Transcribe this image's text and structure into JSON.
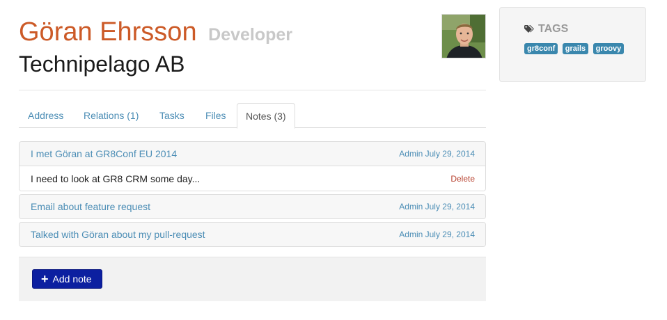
{
  "person": {
    "name": "Göran Ehrsson",
    "title": "Developer",
    "company": "Technipelago AB"
  },
  "tabs": [
    {
      "label": "Address",
      "active": false
    },
    {
      "label": "Relations (1)",
      "active": false
    },
    {
      "label": "Tasks",
      "active": false
    },
    {
      "label": "Files",
      "active": false
    },
    {
      "label": "Notes (3)",
      "active": true
    }
  ],
  "notes": [
    {
      "subject": "I met Göran at GR8Conf EU 2014",
      "meta": "Admin July 29, 2014",
      "body": "I need to look at GR8 CRM some day...",
      "delete_label": "Delete",
      "expanded": true
    },
    {
      "subject": "Email about feature request",
      "meta": "Admin July 29, 2014",
      "expanded": false
    },
    {
      "subject": "Talked with Göran about my pull-request",
      "meta": "Admin July 29, 2014",
      "expanded": false
    }
  ],
  "actions": {
    "add_note_label": "Add note"
  },
  "sidebar": {
    "tags_title": "TAGS",
    "tags": [
      "gr8conf",
      "grails",
      "groovy"
    ]
  },
  "colors": {
    "name": "#cc5a27",
    "link": "#4b8db5",
    "tag": "#3a87ad",
    "primary_button": "#0c1fa0",
    "delete": "#b7402e"
  },
  "icons": {
    "tags": "tags-icon",
    "add": "plus-icon"
  }
}
